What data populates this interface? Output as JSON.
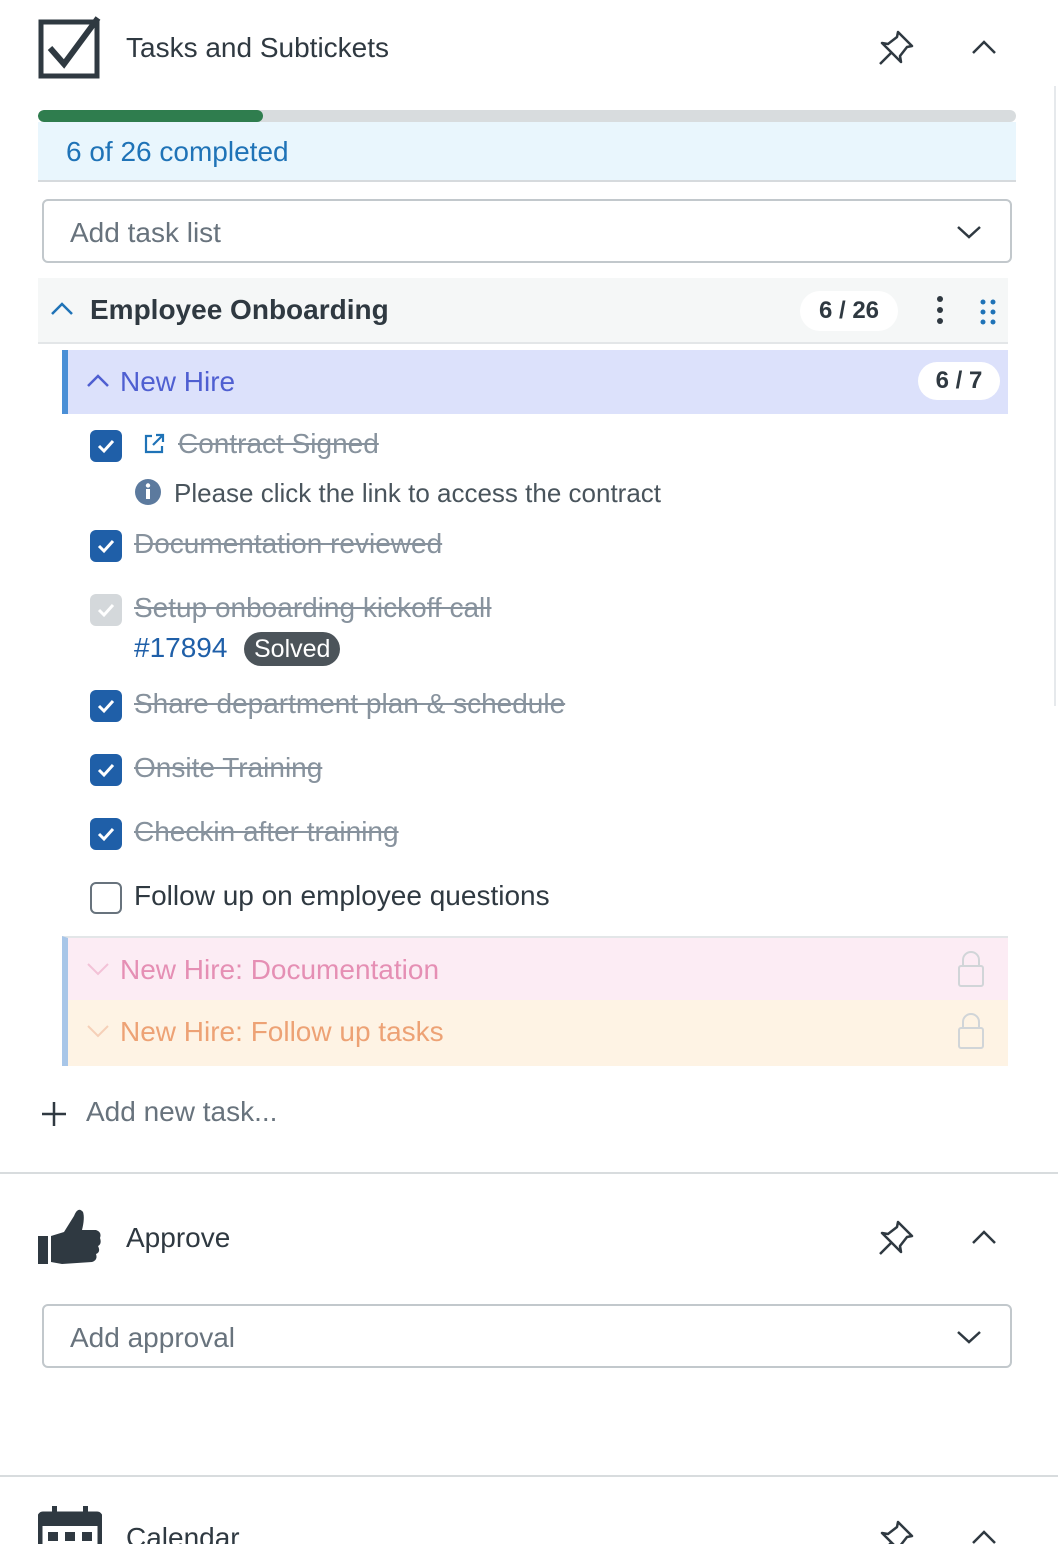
{
  "tasks_panel": {
    "title": "Tasks and Subtickets",
    "icon": "checkbox-icon",
    "progress": {
      "completed": 6,
      "total": 26,
      "fraction": 0.23,
      "text": "6 of 26 completed",
      "fill_color": "#2f7d4e"
    },
    "add_task_list_placeholder": "Add task list",
    "group": {
      "title": "Employee Onboarding",
      "count": "6 / 26",
      "sublists": [
        {
          "title": "New Hire",
          "count": "6 / 7",
          "expanded": true,
          "color": "#4f5fd1",
          "bg": "#dce1fb"
        },
        {
          "title": "New Hire: Documentation",
          "expanded": false,
          "locked": true,
          "color": "#e58fb4",
          "bg": "#fcecf4"
        },
        {
          "title": "New Hire: Follow up tasks",
          "expanded": false,
          "locked": true,
          "color": "#eda275",
          "bg": "#fef3e4"
        }
      ],
      "tasks": [
        {
          "label": "Contract Signed",
          "done": true,
          "note": "Please click the link to access the contract"
        },
        {
          "label": "Documentation reviewed",
          "done": true
        },
        {
          "label": "Setup onboarding kickoff call",
          "done": true,
          "ticket": "#17894",
          "ticket_status": "Solved"
        },
        {
          "label": "Share department plan & schedule",
          "done": true
        },
        {
          "label": "Onsite Training",
          "done": true
        },
        {
          "label": "Checkin after training",
          "done": true
        },
        {
          "label": "Follow up on employee questions",
          "done": false
        }
      ]
    },
    "add_new_task": "Add new task..."
  },
  "approve_panel": {
    "title": "Approve",
    "icon": "thumbs-up-icon",
    "add_approval_placeholder": "Add approval"
  },
  "calendar_panel": {
    "title": "Calendar",
    "icon": "calendar-icon"
  }
}
